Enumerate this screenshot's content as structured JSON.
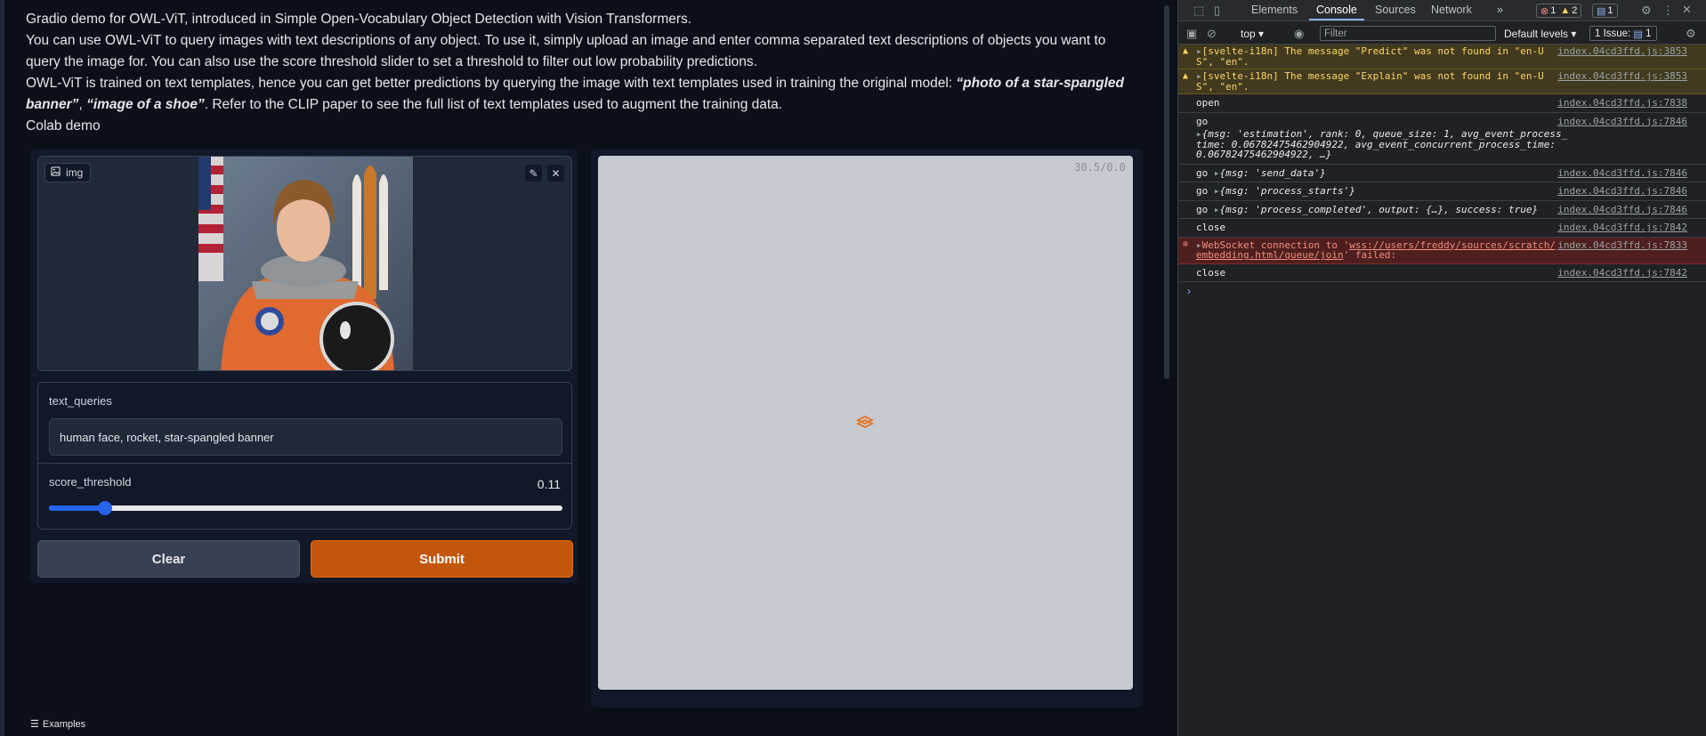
{
  "app": {
    "desc_line1": "Gradio demo for OWL-ViT, introduced in Simple Open-Vocabulary Object Detection with Vision Transformers.",
    "desc_line2": "You can use OWL-ViT to query images with text descriptions of any object. To use it, simply upload an image and enter comma separated text descriptions of objects you want to query the image for. You can also use the score threshold slider to set a threshold to filter out low probability predictions.",
    "desc_line3_a": "OWL-ViT is trained on text templates, hence you can get better predictions by querying the image with text templates used in training the original model: ",
    "desc_line3_em1": "“photo of a star-spangled banner”",
    "desc_line3_b": ", ",
    "desc_line3_em2": "“image of a shoe”",
    "desc_line3_c": ". Refer to the CLIP paper to see the full list of text templates used to augment the training data.",
    "desc_line4": "Colab demo",
    "img_label": "img",
    "text_queries_label": "text_queries",
    "text_queries_value": "human face, rocket, star-spangled banner",
    "score_threshold_label": "score_threshold",
    "score_threshold_value": "0.11",
    "slider_fraction": 0.11,
    "clear_label": "Clear",
    "submit_label": "Submit",
    "timer": "30.5/0.0",
    "examples_label": "Examples",
    "accent_color": "#c2570c"
  },
  "devtools": {
    "tabs": [
      "Elements",
      "Console",
      "Sources",
      "Network"
    ],
    "more": "»",
    "err_count": "1",
    "warn_count": "2",
    "info_count": "1",
    "context": "top",
    "filter_placeholder": "Filter",
    "levels": "Default levels",
    "issues": "1 Issue:",
    "issues_count": "1",
    "rows": [
      {
        "type": "warn",
        "msg": "[svelte-i18n] The message \"Predict\" was not found in \"en-US\", \"en\".",
        "src": "index.04cd3ffd.js:3853"
      },
      {
        "type": "warn",
        "msg": "[svelte-i18n] The message \"Explain\" was not found in \"en-US\", \"en\".",
        "src": "index.04cd3ffd.js:3853"
      },
      {
        "type": "log",
        "msg": "open",
        "src": "index.04cd3ffd.js:7838"
      },
      {
        "type": "log",
        "msg": "go",
        "src": "index.04cd3ffd.js:7846"
      },
      {
        "type": "log",
        "msg": "go",
        "src": "index.04cd3ffd.js:7846"
      },
      {
        "type": "log",
        "msg": "go",
        "src": "index.04cd3ffd.js:7846"
      },
      {
        "type": "log",
        "msg": "go",
        "src": "index.04cd3ffd.js:7846"
      },
      {
        "type": "log",
        "msg": "close",
        "src": "index.04cd3ffd.js:7842"
      },
      {
        "type": "err",
        "msg": "WebSocket connection to '",
        "src": "index.04cd3ffd.js:7833"
      },
      {
        "type": "log",
        "msg": "close",
        "src": "index.04cd3ffd.js:7842"
      }
    ],
    "estimation_obj": "{msg: 'estimation', rank: 0, queue_size: 1, avg_event_process_time: 0.06782475462904922, avg_event_concurrent_process_time: 0.06782475462904922, …}",
    "send_data_obj": "{msg: 'send_data'}",
    "process_starts_obj": "{msg: 'process_starts'}",
    "process_completed_obj": "{msg: 'process_completed', output: {…}, success: true}",
    "ws_url": "wss://users/freddy/sources/scratch/embedding.html/queue/join",
    "ws_failed": "' failed:"
  }
}
